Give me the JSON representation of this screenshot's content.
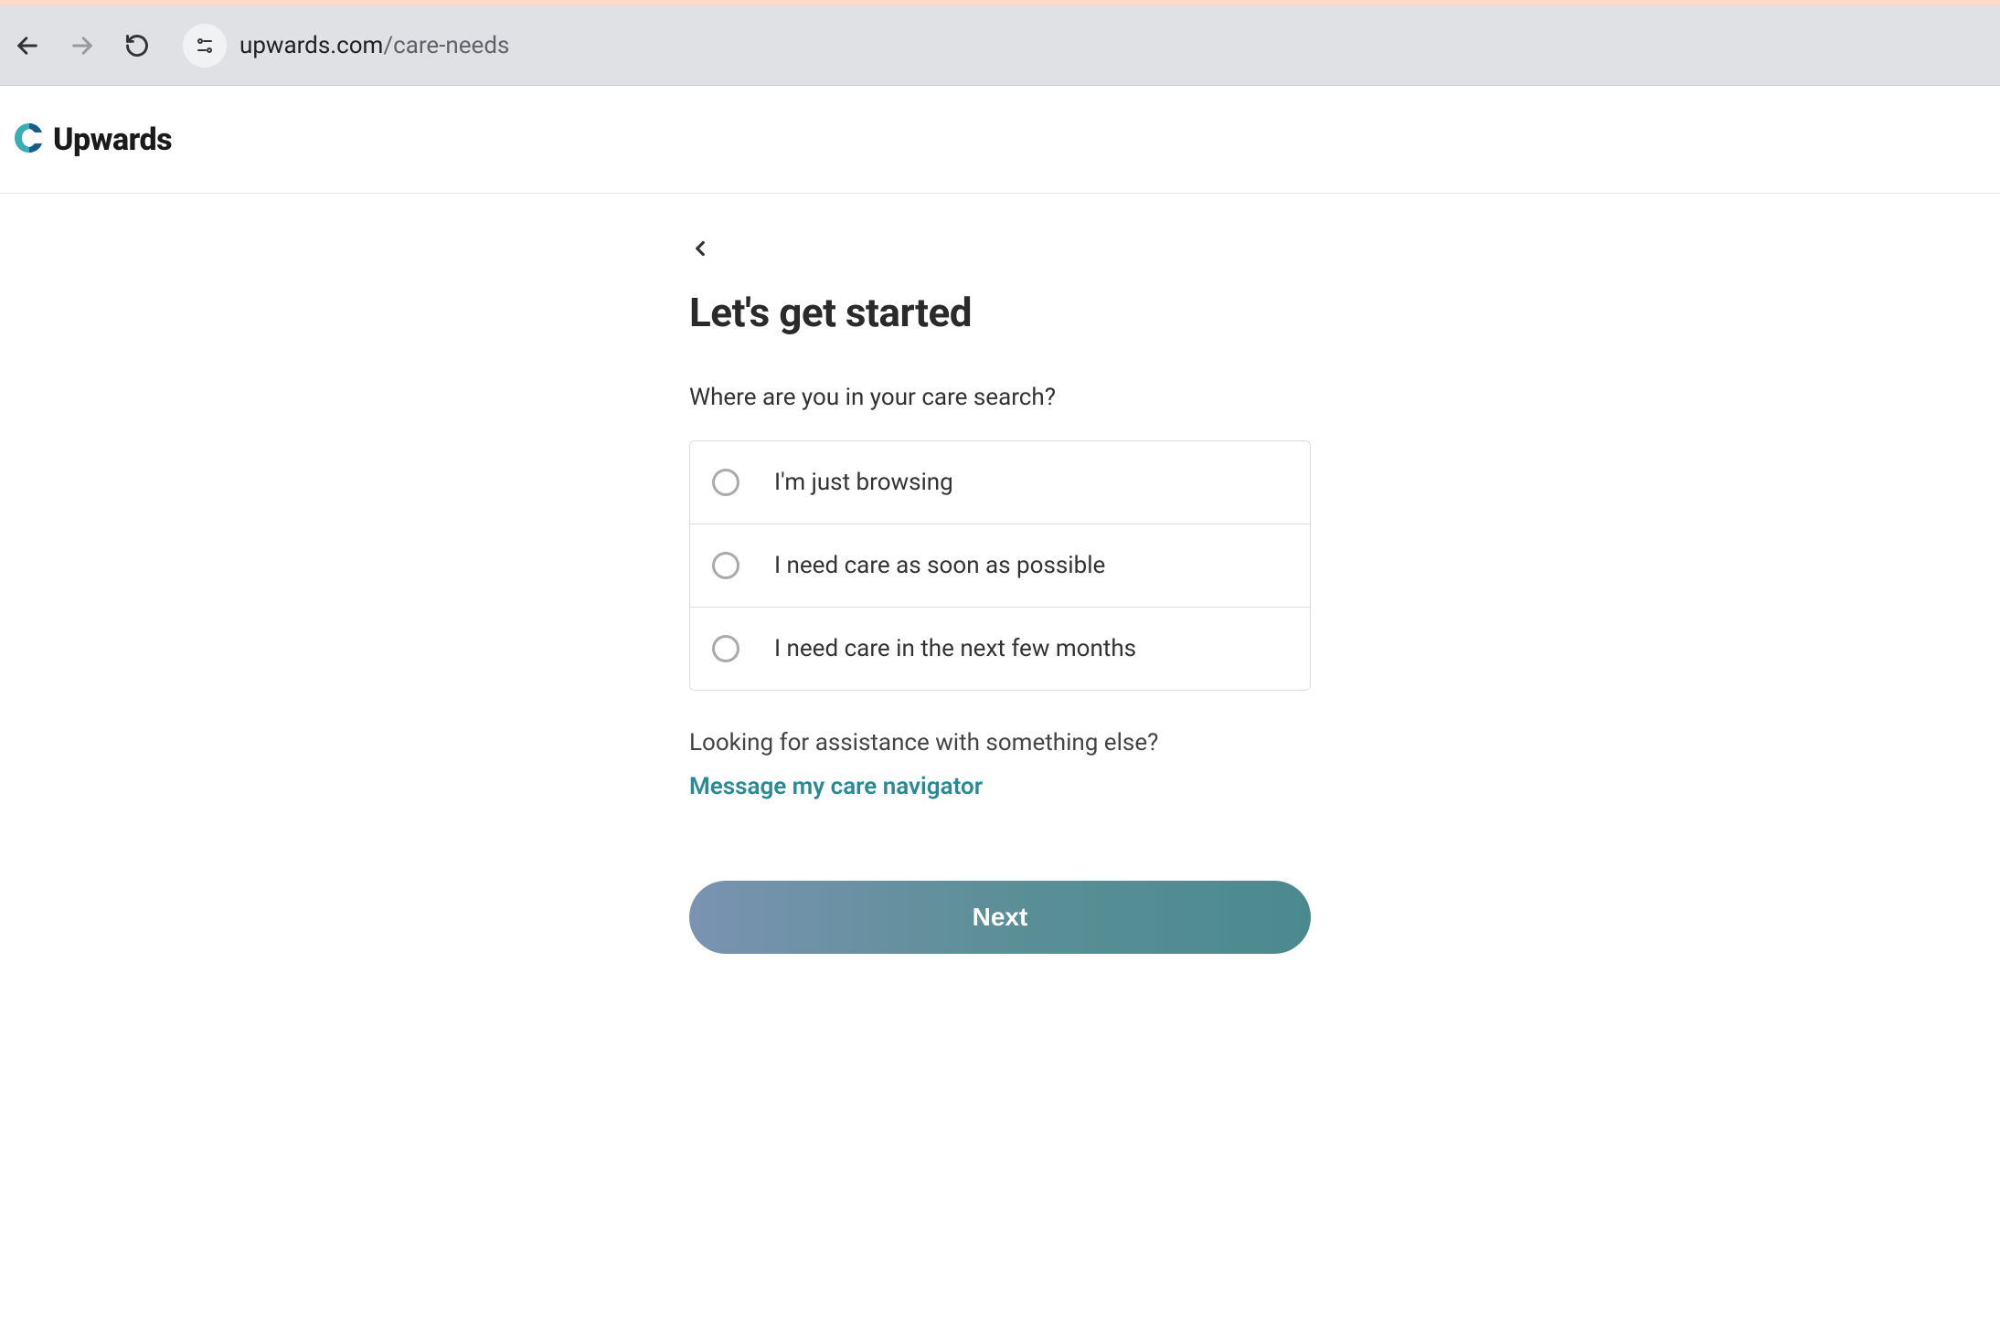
{
  "browser": {
    "url_domain": "upwards.com",
    "url_path": "/care-needs"
  },
  "header": {
    "logo_text": "Upwards"
  },
  "main": {
    "title": "Let's get started",
    "question": "Where are you in your care search?",
    "options": [
      {
        "label": "I'm just browsing"
      },
      {
        "label": "I need care as soon as possible"
      },
      {
        "label": "I need care in the next few months"
      }
    ],
    "assist_text": "Looking for assistance with something else?",
    "link_text": "Message my care navigator",
    "next_label": "Next"
  }
}
